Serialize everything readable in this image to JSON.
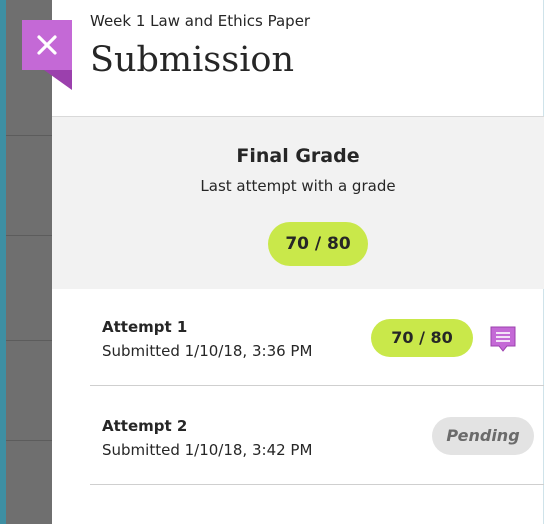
{
  "header": {
    "subtitle": "Week 1 Law and Ethics Paper",
    "title": "Submission",
    "close_icon": "close-icon"
  },
  "final_grade": {
    "title": "Final Grade",
    "subtitle": "Last attempt with a grade",
    "grade": "70 / 80"
  },
  "attempts": [
    {
      "name": "Attempt 1",
      "submitted": "Submitted 1/10/18, 3:36 PM",
      "grade": "70 / 80",
      "icon": "feedback-comment-icon"
    },
    {
      "name": "Attempt 2",
      "submitted": "Submitted 1/10/18, 3:42 PM",
      "status": "Pending"
    }
  ],
  "colors": {
    "accent_purple": "#c469d6",
    "grade_green": "#c9e84a",
    "pending_gray": "#e3e3e3",
    "backdrop": "#6f6f6f"
  }
}
